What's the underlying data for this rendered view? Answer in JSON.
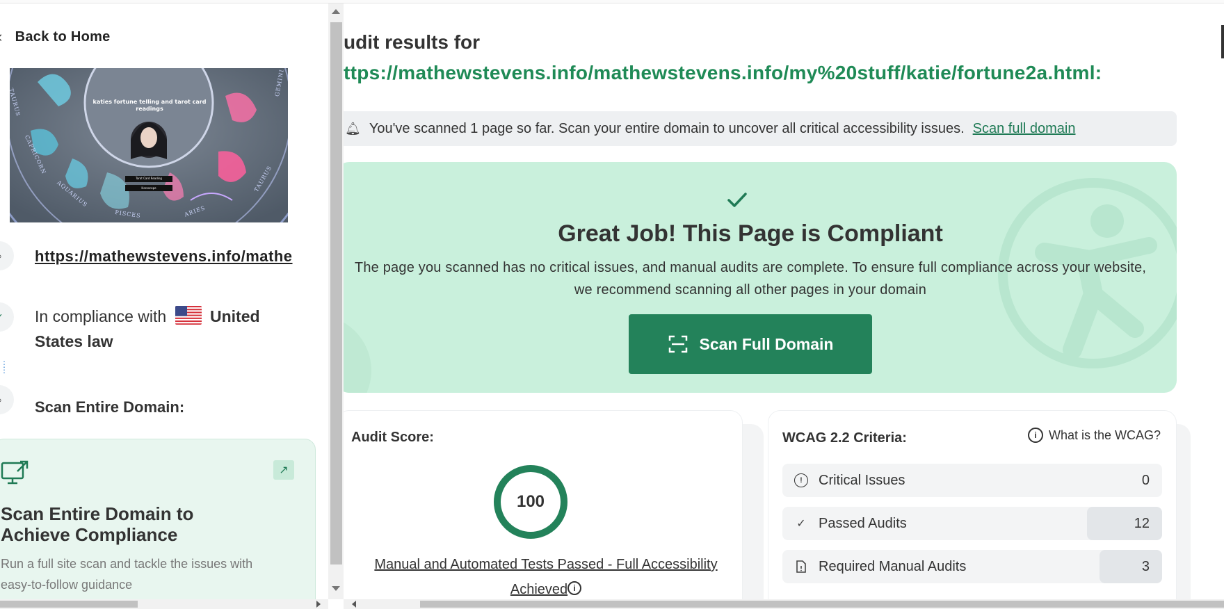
{
  "left": {
    "back_label": "Back to Home",
    "thumbnail": {
      "site_title": "katies fortune telling and tarot card readings",
      "button1": "Tarot Card Reading",
      "button2": "Horoscope",
      "zodiac_words": [
        "TAURUS",
        "CAPRICORN",
        "AQUARIUS",
        "PISCES",
        "ARIES",
        "GEMINI",
        "TAURUS"
      ]
    },
    "url": "https://mathewstevens.info/mathe",
    "compliance_prefix": "In compliance with",
    "compliance_country": "United States law",
    "scan_entire_label": "Scan Entire Domain:",
    "card": {
      "title": "Scan Entire Domain to Achieve Compliance",
      "description": "Run a full site scan and tackle the issues with easy-to-follow guidance"
    }
  },
  "main": {
    "title": "udit results for",
    "url": "ttps://mathewstevens.info/mathewstevens.info/my%20stuff/katie/fortune2a.html:",
    "notice": {
      "text": "You've scanned 1 page so far. Scan your entire domain to uncover all critical accessibility issues.",
      "link": "Scan full domain"
    },
    "hero": {
      "title": "Great Job! This Page is Compliant",
      "description": "The page you scanned has no critical issues, and manual audits are complete. To ensure full compliance across your website, we recommend scanning all other pages in your domain",
      "button": "Scan Full Domain"
    },
    "score": {
      "label": "Audit Score:",
      "value": "100",
      "score_fraction": 1.0,
      "caption": "Manual and Automated Tests Passed - Full Accessibility Achieved"
    },
    "wcag": {
      "label": "WCAG 2.2 Criteria:",
      "help": "What is the WCAG?",
      "rows": [
        {
          "label": "Critical Issues",
          "value": "0",
          "icon": "alert-circle-icon"
        },
        {
          "label": "Passed Audits",
          "value": "12",
          "icon": "check-icon"
        },
        {
          "label": "Required Manual Audits",
          "value": "3",
          "icon": "document-icon"
        }
      ]
    }
  },
  "colors": {
    "accent": "#23825a",
    "link_green": "#1f8a56",
    "hero_bg": "#c9f0dc",
    "card_bg": "#e8f6ef"
  }
}
